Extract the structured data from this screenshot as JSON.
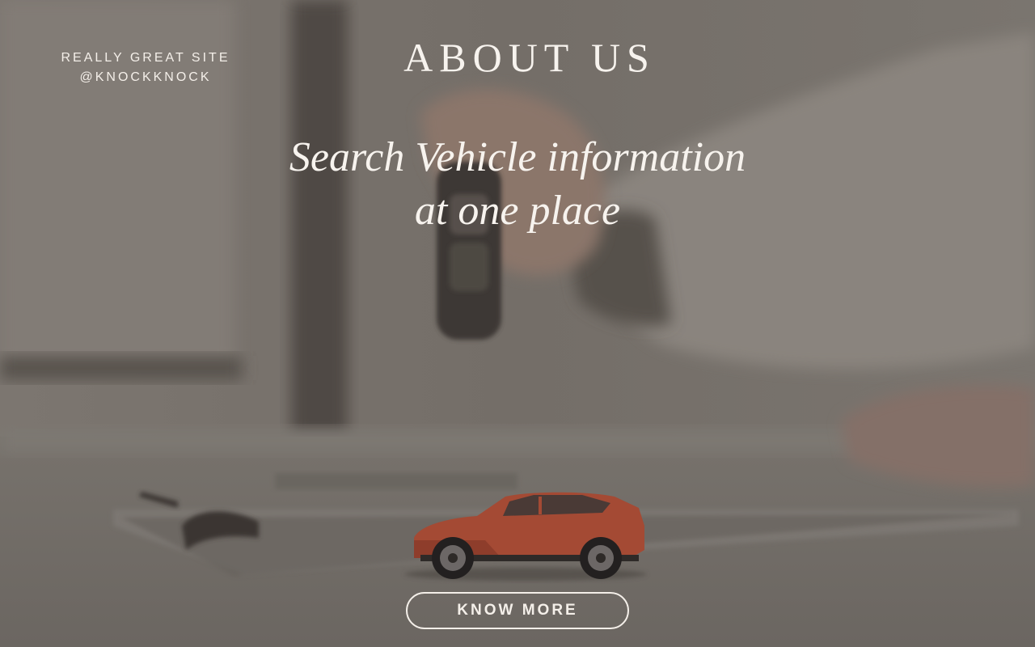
{
  "site": {
    "name": "REALLY GREAT SITE",
    "handle": "@KNOCKKNOCK"
  },
  "page": {
    "title": "ABOUT US",
    "tagline_line1": "Search Vehicle information",
    "tagline_line2": "at one place"
  },
  "cta": {
    "label": "KNOW MORE"
  },
  "colors": {
    "overlay": "#6d6761",
    "text": "#f4efe9",
    "car": "#a44a34"
  }
}
